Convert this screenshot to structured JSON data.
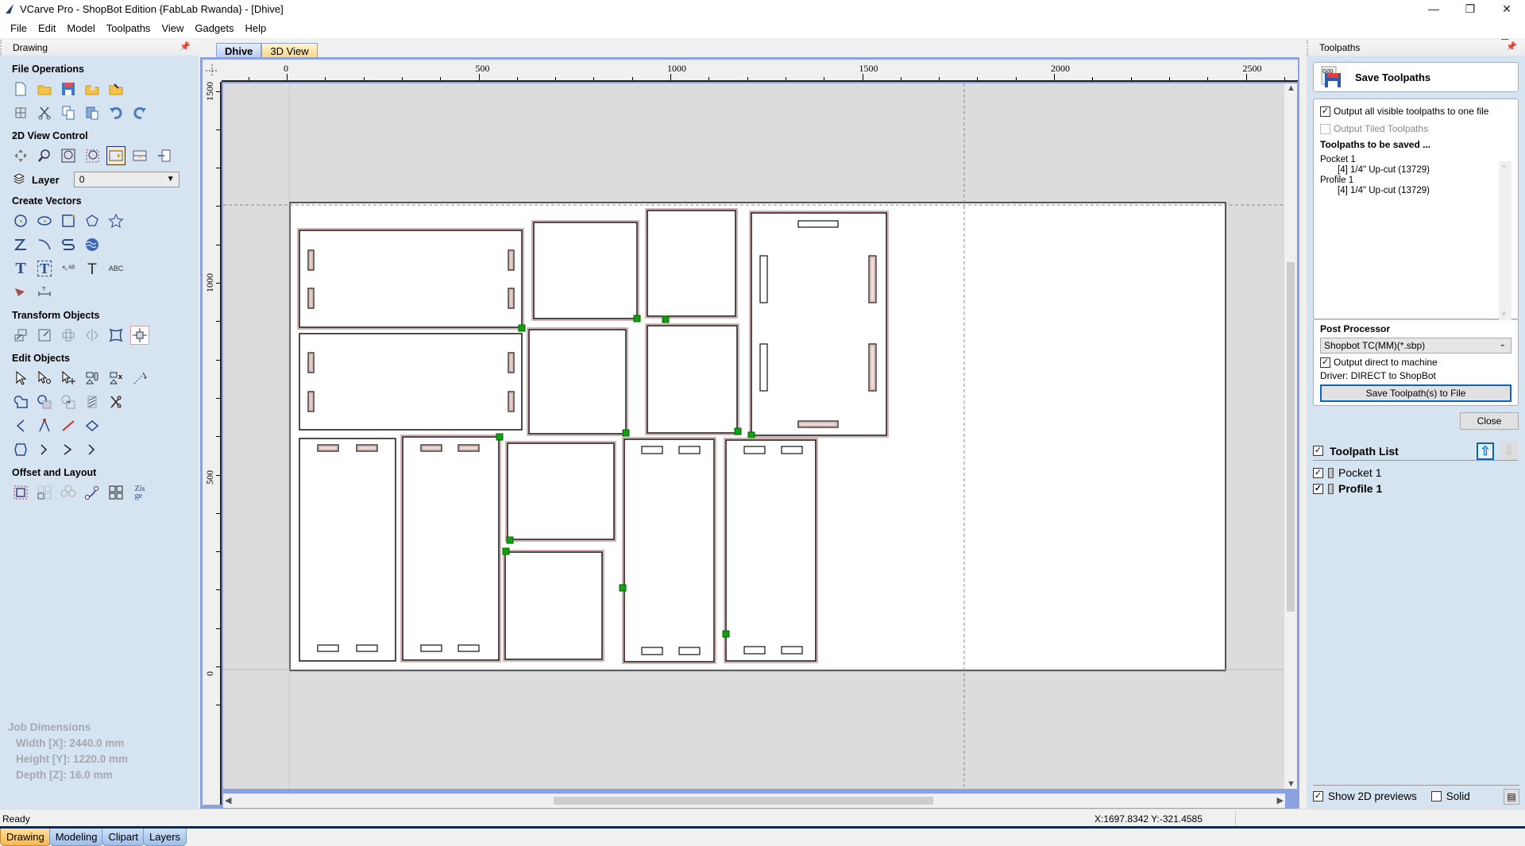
{
  "window": {
    "title": "VCarve Pro - ShopBot Edition {FabLab Rwanda} - [Dhive]",
    "controls": {
      "minimize": "—",
      "maximize": "❐",
      "close": "✕"
    },
    "mdi_controls": {
      "minimize": "_",
      "restore": "❐",
      "close": "✕"
    }
  },
  "menu": [
    "File",
    "Edit",
    "Model",
    "Toolpaths",
    "View",
    "Gadgets",
    "Help"
  ],
  "left_panel": {
    "title": "Drawing",
    "sections": {
      "file_operations": "File Operations",
      "view_control": "2D View Control",
      "create_vectors": "Create Vectors",
      "transform_objects": "Transform Objects",
      "edit_objects": "Edit Objects",
      "offset_layout": "Offset and Layout"
    },
    "layer_label": "Layer",
    "layer_value": "0",
    "job_dimensions": {
      "title": "Job Dimensions",
      "width": "Width  [X]: 2440.0 mm",
      "height": "Height [Y]: 1220.0 mm",
      "depth": "Depth  [Z]: 16.0 mm"
    },
    "bottom_tabs": [
      {
        "label": "Drawing",
        "active": true
      },
      {
        "label": "Modeling",
        "active": false
      },
      {
        "label": "Clipart",
        "active": false
      },
      {
        "label": "Layers",
        "active": false
      }
    ]
  },
  "document": {
    "tabs": [
      {
        "label": "Dhive",
        "active": true
      },
      {
        "label": "3D View",
        "active": false
      }
    ],
    "ruler_x_labels": [
      "0",
      "500",
      "1000",
      "1500",
      "2000",
      "2500"
    ],
    "ruler_y_labels": [
      "1500",
      "1000",
      "500",
      "0"
    ]
  },
  "right_panel": {
    "title": "Toolpaths",
    "save_title": "Save Toolpaths",
    "output_all_label": "Output all visible toolpaths to one file",
    "output_all_checked": true,
    "output_tiled_label": "Output Tiled Toolpaths",
    "output_tiled_checked": false,
    "to_be_saved_title": "Toolpaths to be saved ...",
    "to_be_saved": [
      {
        "name": "Pocket 1",
        "tool": "[4] 1/4\" Up-cut (13729)"
      },
      {
        "name": "Profile 1",
        "tool": "[4] 1/4\" Up-cut (13729)"
      }
    ],
    "post_processor_title": "Post Processor",
    "post_processor_value": "Shopbot TC(MM)(*.sbp)",
    "output_direct_label": "Output direct to machine",
    "output_direct_checked": true,
    "driver_text": "Driver: DIRECT to ShopBot",
    "save_button": "Save Toolpath(s) to File",
    "close_button": "Close",
    "toolpath_list_title": "Toolpath List",
    "toolpath_list": [
      {
        "name": "Pocket 1",
        "checked": true
      },
      {
        "name": "Profile 1",
        "checked": true
      }
    ],
    "show_previews_label": "Show 2D previews",
    "show_previews_checked": true,
    "solid_label": "Solid",
    "solid_checked": false
  },
  "status": {
    "ready": "Ready",
    "coords": "X:1697.8342 Y:-321.4585"
  },
  "colors": {
    "panel_bg": "#d6e3f1",
    "frame_blue": "#8aa3e0",
    "toolpath_pink": "#c79a9a",
    "start_marker": "#10a010"
  }
}
